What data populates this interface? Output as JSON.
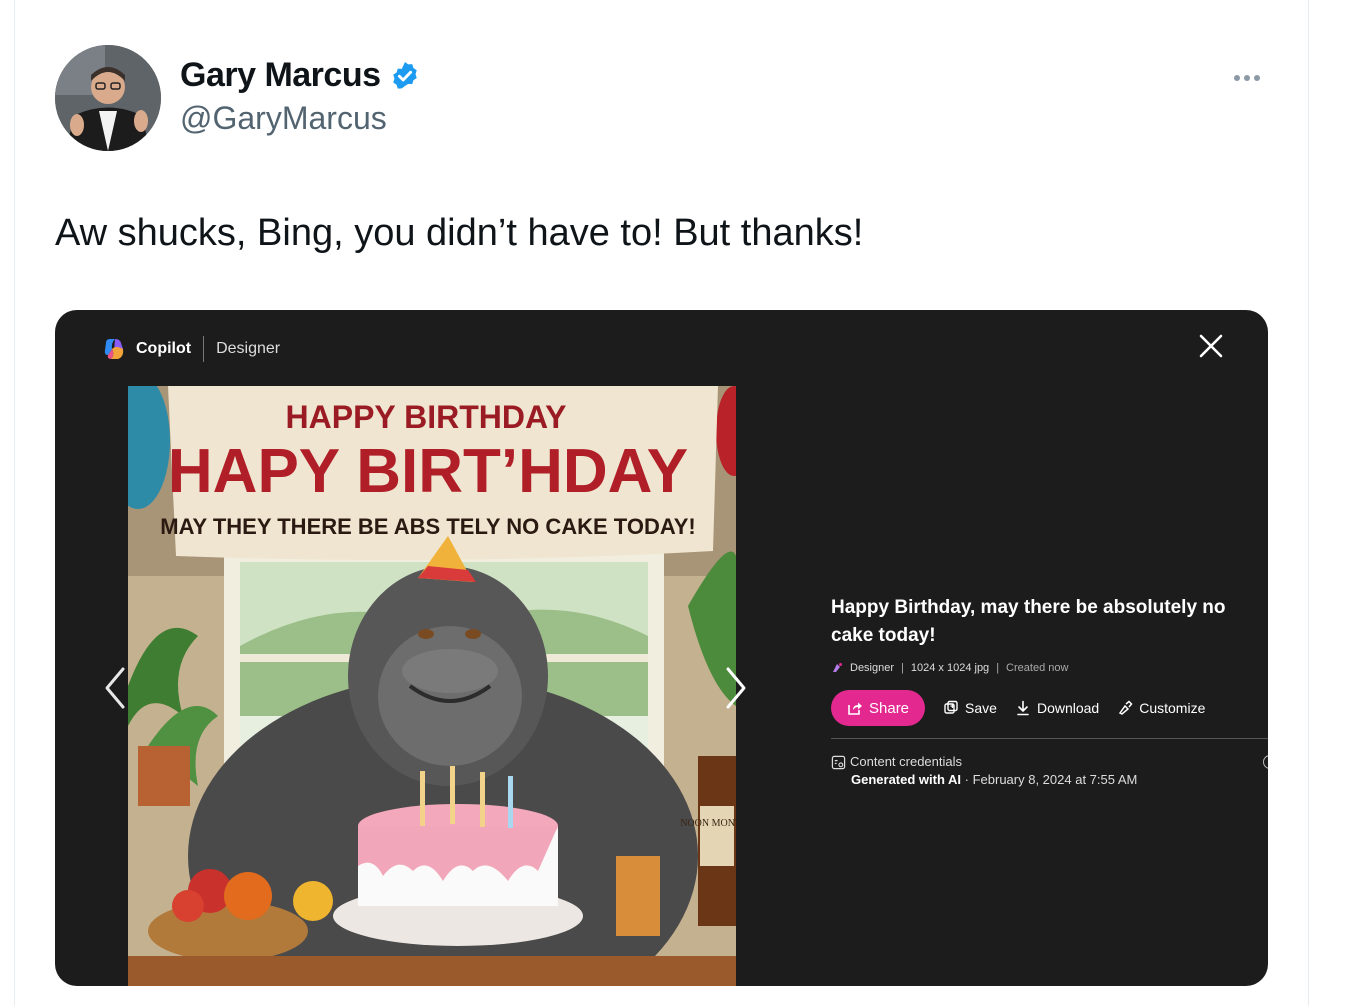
{
  "tweet": {
    "author_name": "Gary Marcus",
    "handle": "@GaryMarcus",
    "text": "Aw shucks, Bing, you didn’t have to! But thanks!"
  },
  "media": {
    "brand": "Copilot",
    "section": "Designer",
    "image": {
      "banner_small": "HAPPY BIRTHDAY",
      "banner_large": "HAPY BIRT’HDAY",
      "banner_sub": "MAY THEY THERE BE ABS TELY NO CAKE TODAY!",
      "bottle_label": "NOON MONTHS"
    },
    "title": "Happy Birthday, may there be absolutely no cake today!",
    "meta": {
      "source": "Designer",
      "size": "1024 x 1024 jpg",
      "created": "Created now"
    },
    "actions": {
      "share": "Share",
      "save": "Save",
      "download": "Download",
      "customize": "Customize"
    },
    "credentials": {
      "label": "Content credentials",
      "generated": "Generated with AI",
      "date": " · February 8, 2024 at 7:55 AM"
    },
    "accent_color": "#e3288f"
  },
  "colors": {
    "verified": "#1d9bf0",
    "handle": "#536471"
  }
}
